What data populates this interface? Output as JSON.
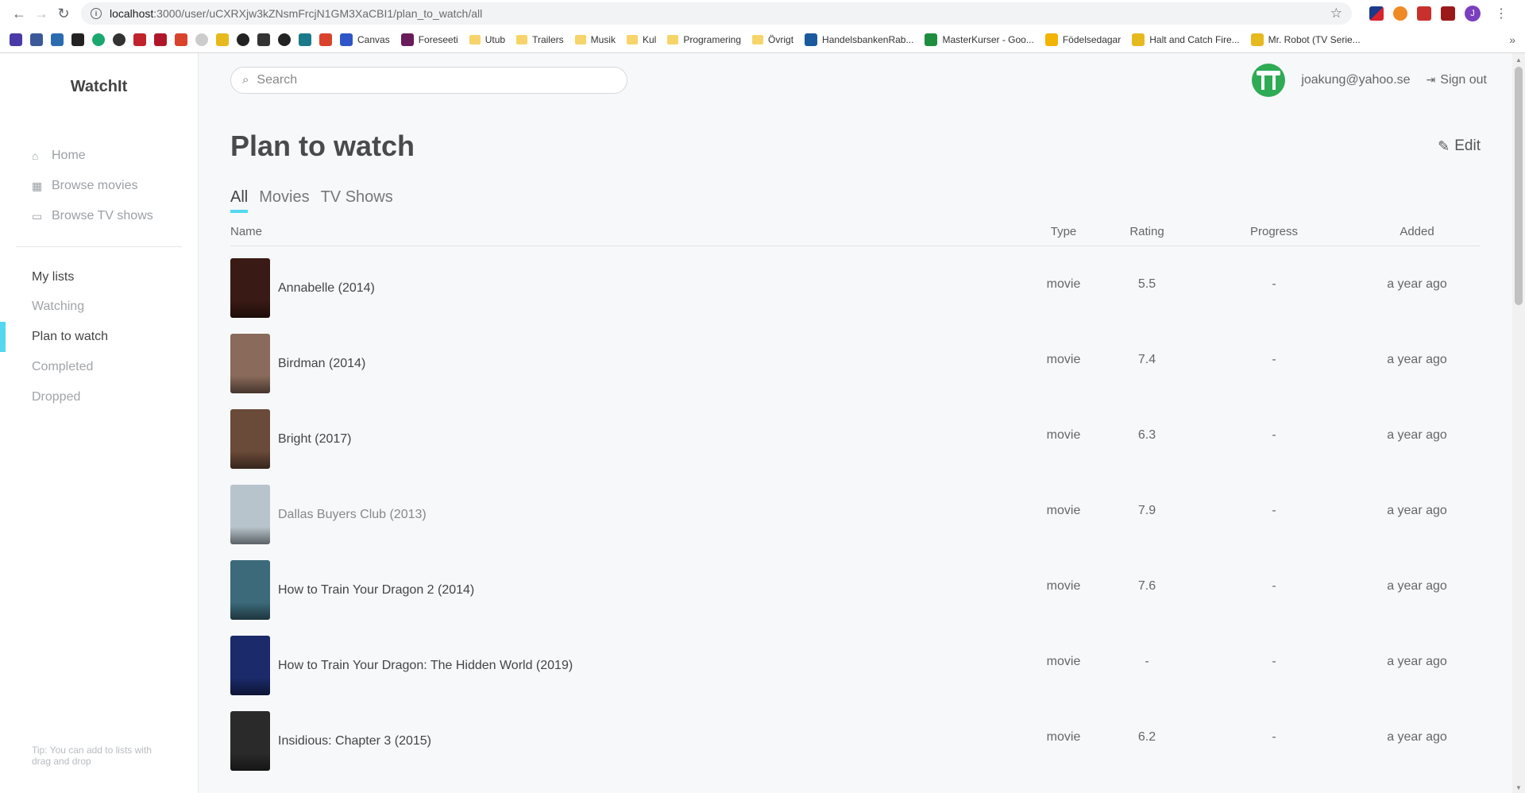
{
  "browser": {
    "url_host": "localhost",
    "url_path": ":3000/user/uCXRXjw3kZNsmFrcjN1GM3XaCBI1/plan_to_watch/all",
    "profile_initial": "J",
    "bookmarks": [
      {
        "label": "Canvas",
        "icon": "canvas-icon",
        "color": "#2d55c8"
      },
      {
        "label": "Foreseeti",
        "icon": "foreseeti-icon",
        "color": "#6a1b5a"
      },
      {
        "label": "Utub",
        "icon": "folder-icon",
        "color": "#f7d46a"
      },
      {
        "label": "Trailers",
        "icon": "folder-icon",
        "color": "#f7d46a"
      },
      {
        "label": "Musik",
        "icon": "folder-icon",
        "color": "#f7d46a"
      },
      {
        "label": "Kul",
        "icon": "folder-icon",
        "color": "#f7d46a"
      },
      {
        "label": "Programering",
        "icon": "folder-icon",
        "color": "#f7d46a"
      },
      {
        "label": "Övrigt",
        "icon": "folder-icon",
        "color": "#f7d46a"
      },
      {
        "label": "HandelsbankenRab...",
        "icon": "handelsbanken-icon",
        "color": "#1a5a9c"
      },
      {
        "label": "MasterKurser - Goo...",
        "icon": "sheets-icon",
        "color": "#1e8e3e"
      },
      {
        "label": "Födelsedagar",
        "icon": "drive-icon",
        "color": "#f2b400"
      },
      {
        "label": "Halt and Catch Fire...",
        "icon": "imdb-icon",
        "color": "#e6b91e"
      },
      {
        "label": "Mr. Robot (TV Serie...",
        "icon": "imdb-icon",
        "color": "#e6b91e"
      }
    ]
  },
  "app": {
    "logo": "WatchIt",
    "nav": [
      {
        "label": "Home",
        "icon": "home-icon",
        "glyph": "⌂"
      },
      {
        "label": "Browse movies",
        "icon": "film-icon",
        "glyph": "▦"
      },
      {
        "label": "Browse TV shows",
        "icon": "tv-icon",
        "glyph": "▭"
      }
    ],
    "my_lists_heading": "My lists",
    "lists": [
      "Watching",
      "Plan to watch",
      "Completed",
      "Dropped"
    ],
    "tip": "Tip: You can add to lists with drag and drop"
  },
  "header": {
    "search_placeholder": "Search",
    "email": "joakung@yahoo.se",
    "signout": "Sign out"
  },
  "page": {
    "title": "Plan to watch",
    "edit": "Edit",
    "tabs": [
      "All",
      "Movies",
      "TV Shows"
    ],
    "columns": {
      "name": "Name",
      "type": "Type",
      "rating": "Rating",
      "progress": "Progress",
      "added": "Added"
    },
    "rows": [
      {
        "title": "Annabelle (2014)",
        "type": "movie",
        "rating": "5.5",
        "progress": "-",
        "added": "a year ago",
        "poster_color": "#3a1a14"
      },
      {
        "title": "Birdman (2014)",
        "type": "movie",
        "rating": "7.4",
        "progress": "-",
        "added": "a year ago",
        "poster_color": "#8a6a5a"
      },
      {
        "title": "Bright (2017)",
        "type": "movie",
        "rating": "6.3",
        "progress": "-",
        "added": "a year ago",
        "poster_color": "#6a4a38"
      },
      {
        "title": "Dallas Buyers Club (2013)",
        "type": "movie",
        "rating": "7.9",
        "progress": "-",
        "added": "a year ago",
        "poster_color": "#b8c4cc"
      },
      {
        "title": "How to Train Your Dragon 2 (2014)",
        "type": "movie",
        "rating": "7.6",
        "progress": "-",
        "added": "a year ago",
        "poster_color": "#3c6a7a"
      },
      {
        "title": "How to Train Your Dragon: The Hidden World (2019)",
        "type": "movie",
        "rating": "-",
        "progress": "-",
        "added": "a year ago",
        "poster_color": "#1a2a6a"
      },
      {
        "title": "Insidious: Chapter 3 (2015)",
        "type": "movie",
        "rating": "6.2",
        "progress": "-",
        "added": "a year ago",
        "poster_color": "#2a2a2a"
      }
    ]
  }
}
